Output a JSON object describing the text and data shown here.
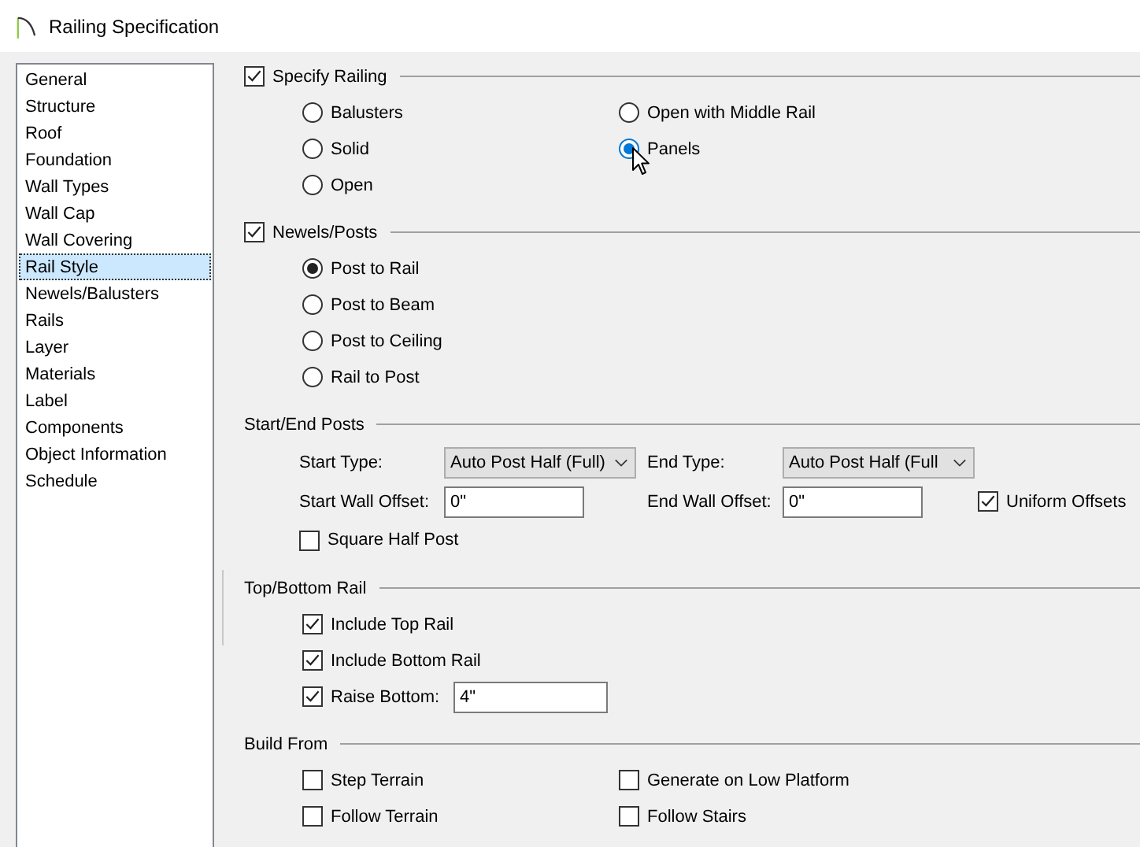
{
  "window": {
    "title": "Railing Specification"
  },
  "sidebar": {
    "items": [
      {
        "label": "General",
        "selected": false
      },
      {
        "label": "Structure",
        "selected": false
      },
      {
        "label": "Roof",
        "selected": false
      },
      {
        "label": "Foundation",
        "selected": false
      },
      {
        "label": "Wall Types",
        "selected": false
      },
      {
        "label": "Wall Cap",
        "selected": false
      },
      {
        "label": "Wall Covering",
        "selected": false
      },
      {
        "label": "Rail Style",
        "selected": true
      },
      {
        "label": "Newels/Balusters",
        "selected": false
      },
      {
        "label": "Rails",
        "selected": false
      },
      {
        "label": "Layer",
        "selected": false
      },
      {
        "label": "Materials",
        "selected": false
      },
      {
        "label": "Label",
        "selected": false
      },
      {
        "label": "Components",
        "selected": false
      },
      {
        "label": "Object Information",
        "selected": false
      },
      {
        "label": "Schedule",
        "selected": false
      }
    ]
  },
  "sections": [
    {
      "kind": "options",
      "title": "Specify Railing",
      "checked": true,
      "columns": [
        [
          {
            "kind": "radio",
            "label": "Balusters",
            "selected": false,
            "hovered": false
          },
          {
            "kind": "radio",
            "label": "Solid",
            "selected": false,
            "hovered": false
          },
          {
            "kind": "radio",
            "label": "Open",
            "selected": false,
            "hovered": false
          }
        ],
        [
          {
            "kind": "radio",
            "label": "Open with Middle Rail",
            "selected": false,
            "hovered": false
          },
          {
            "kind": "radio",
            "label": "Panels",
            "selected": true,
            "hovered": true
          }
        ]
      ]
    },
    {
      "kind": "options",
      "title": "Newels/Posts",
      "checked": true,
      "columns": [
        [
          {
            "kind": "radio",
            "label": "Post to Rail",
            "selected": true,
            "hovered": false
          },
          {
            "kind": "radio",
            "label": "Post to Beam",
            "selected": false,
            "hovered": false
          },
          {
            "kind": "radio",
            "label": "Post to Ceiling",
            "selected": false,
            "hovered": false
          },
          {
            "kind": "radio",
            "label": "Rail to Post",
            "selected": false,
            "hovered": false
          }
        ]
      ]
    },
    {
      "kind": "fields",
      "title": "Start/End Posts",
      "rows": [
        [
          {
            "kind": "label",
            "text": "Start Type:"
          },
          {
            "kind": "select",
            "value": "Auto Post Half (Full)"
          },
          {
            "kind": "label",
            "text": "End Type:"
          },
          {
            "kind": "select",
            "value": "Auto Post Half (Full"
          }
        ],
        [
          {
            "kind": "label",
            "text": "Start Wall Offset:"
          },
          {
            "kind": "input",
            "value": "0\""
          },
          {
            "kind": "label",
            "text": "End Wall Offset:"
          },
          {
            "kind": "input",
            "value": "0\""
          },
          {
            "kind": "checkbox",
            "label": "Uniform Offsets",
            "checked": true
          }
        ],
        [
          {
            "kind": "checkbox",
            "label": "Square Half Post",
            "checked": false
          }
        ]
      ]
    },
    {
      "kind": "options",
      "title": "Top/Bottom Rail",
      "columns": [
        [
          {
            "kind": "checkbox",
            "label": "Include Top Rail",
            "checked": true
          },
          {
            "kind": "checkbox",
            "label": "Include Bottom Rail",
            "checked": true
          },
          {
            "kind": "checkbox_field",
            "label": "Raise Bottom:",
            "checked": true,
            "value": "4\""
          }
        ]
      ]
    },
    {
      "kind": "options",
      "title": "Build From",
      "columns": [
        [
          {
            "kind": "checkbox",
            "label": "Step Terrain",
            "checked": false
          },
          {
            "kind": "checkbox",
            "label": "Follow Terrain",
            "checked": false
          }
        ],
        [
          {
            "kind": "checkbox",
            "label": "Generate on Low Platform",
            "checked": false
          },
          {
            "kind": "checkbox",
            "label": "Follow Stairs",
            "checked": false
          }
        ]
      ]
    }
  ]
}
